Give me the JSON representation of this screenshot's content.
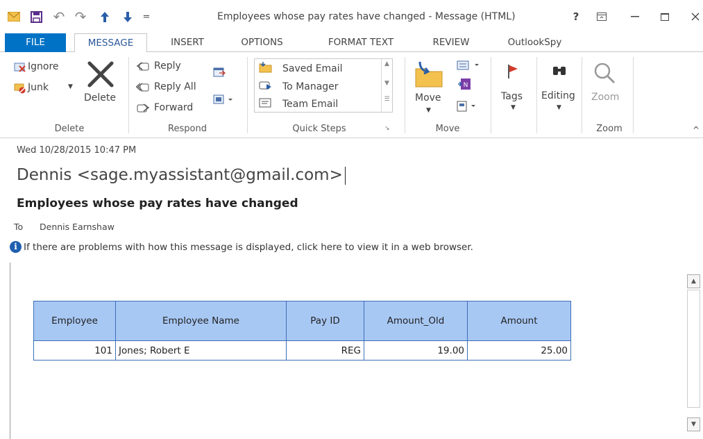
{
  "window": {
    "title": "Employees whose pay rates have changed - Message (HTML)",
    "help": "?",
    "colors": {
      "accent": "#0072c6",
      "table_header": "#a8c8f4",
      "table_border": "#3a6fb5"
    }
  },
  "qat": {
    "customize": "="
  },
  "tabs": [
    {
      "label": "FILE"
    },
    {
      "label": "MESSAGE"
    },
    {
      "label": "INSERT"
    },
    {
      "label": "OPTIONS"
    },
    {
      "label": "FORMAT TEXT"
    },
    {
      "label": "REVIEW"
    },
    {
      "label": "OutlookSpy"
    }
  ],
  "ribbon": {
    "delete": {
      "ignore": "Ignore",
      "junk": "Junk",
      "delete": "Delete",
      "group": "Delete"
    },
    "respond": {
      "reply": "Reply",
      "reply_all": "Reply All",
      "forward": "Forward",
      "group": "Respond"
    },
    "quick_steps": {
      "items": [
        "Saved Email",
        "To Manager",
        "Team Email"
      ],
      "group": "Quick Steps"
    },
    "move": {
      "move": "Move",
      "group": "Move"
    },
    "tags": {
      "label": "Tags"
    },
    "editing": {
      "label": "Editing"
    },
    "zoom": {
      "label": "Zoom",
      "group": "Zoom"
    }
  },
  "message": {
    "date": "Wed 10/28/2015 10:47 PM",
    "sender": "Dennis <sage.myassistant@gmail.com>",
    "subject": "Employees whose pay rates have changed",
    "to_label": "To",
    "to_value": "Dennis Earnshaw",
    "info": "If there are problems with how this message is displayed, click here to view it in a web browser."
  },
  "table": {
    "headers": [
      "Employee",
      "Employee Name",
      "Pay ID",
      "Amount_Old",
      "Amount"
    ],
    "rows": [
      [
        "101",
        "Jones; Robert E",
        "REG",
        "19.00",
        "25.00"
      ]
    ]
  }
}
